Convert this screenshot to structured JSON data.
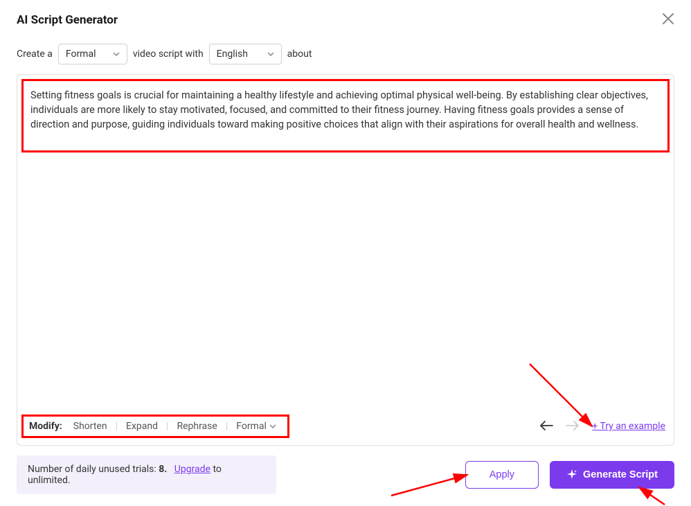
{
  "header": {
    "title": "AI Script Generator"
  },
  "params": {
    "prefix": "Create a",
    "tone_value": "Formal",
    "mid_text": "video script with",
    "language_value": "English",
    "suffix": "about"
  },
  "content": {
    "text": "Setting fitness goals is crucial for maintaining a healthy lifestyle and achieving optimal physical well-being. By establishing clear objectives, individuals are more likely to stay motivated, focused, and committed to their fitness journey. Having fitness goals provides a sense of direction and purpose, guiding individuals toward making positive choices that align with their aspirations for overall health and wellness."
  },
  "modify": {
    "label": "Modify:",
    "shorten": "Shorten",
    "expand": "Expand",
    "rephrase": "Rephrase",
    "formal": "Formal"
  },
  "controls": {
    "try_example": "+ Try an example"
  },
  "footer": {
    "trials_prefix": "Number of daily unused trials: ",
    "trials_count": "8.",
    "upgrade_text": "Upgrade",
    "trials_suffix": " to unlimited.",
    "apply": "Apply",
    "generate": "Generate Script"
  },
  "colors": {
    "accent": "#7c3aed",
    "annotation": "#ff0000"
  }
}
